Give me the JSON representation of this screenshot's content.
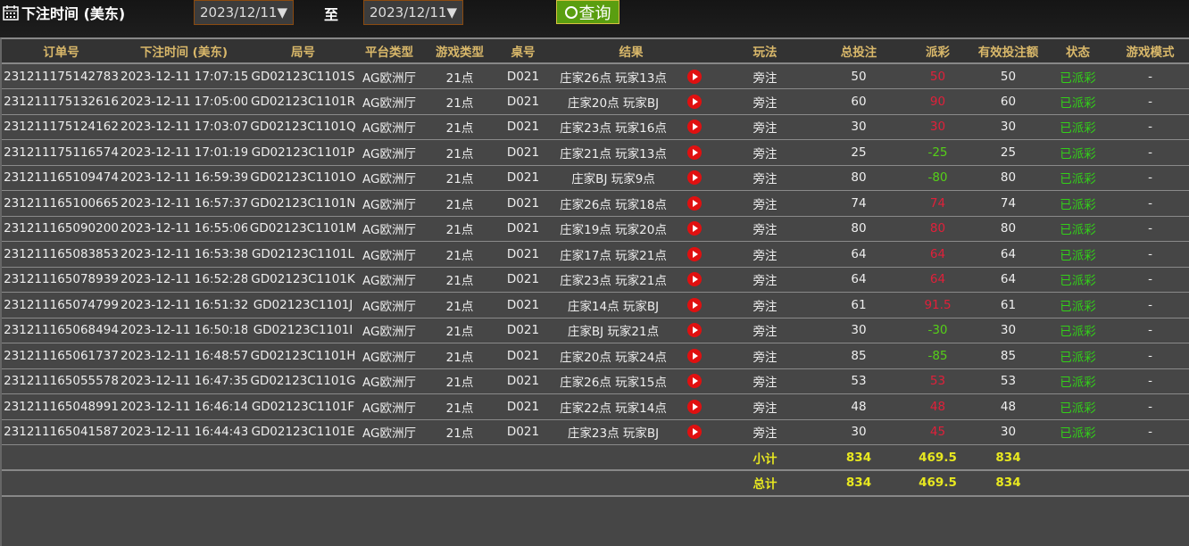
{
  "filter": {
    "label": "下注时间 (美东)",
    "start": "2023/12/11",
    "to": "至",
    "end": "2023/12/11",
    "query": "查询"
  },
  "columns": [
    "订单号",
    "下注时间 (美东)",
    "局号",
    "平台类型",
    "游戏类型",
    "桌号",
    "结果",
    "玩法",
    "总投注",
    "派彩",
    "有效投注额",
    "状态",
    "游戏模式"
  ],
  "rows": [
    [
      "231211175142783",
      "2023-12-11 17:07:15",
      "GD02123C1101S",
      "AG欧洲厅",
      "21点",
      "D021",
      "庄家26点 玩家13点",
      "旁注",
      "50",
      "50",
      "50",
      "已派彩",
      "-"
    ],
    [
      "231211175132616",
      "2023-12-11 17:05:00",
      "GD02123C1101R",
      "AG欧洲厅",
      "21点",
      "D021",
      "庄家20点 玩家BJ",
      "旁注",
      "60",
      "90",
      "60",
      "已派彩",
      "-"
    ],
    [
      "231211175124162",
      "2023-12-11 17:03:07",
      "GD02123C1101Q",
      "AG欧洲厅",
      "21点",
      "D021",
      "庄家23点 玩家16点",
      "旁注",
      "30",
      "30",
      "30",
      "已派彩",
      "-"
    ],
    [
      "231211175116574",
      "2023-12-11 17:01:19",
      "GD02123C1101P",
      "AG欧洲厅",
      "21点",
      "D021",
      "庄家21点 玩家13点",
      "旁注",
      "25",
      "-25",
      "25",
      "已派彩",
      "-"
    ],
    [
      "231211165109474",
      "2023-12-11 16:59:39",
      "GD02123C1101O",
      "AG欧洲厅",
      "21点",
      "D021",
      "庄家BJ 玩家9点",
      "旁注",
      "80",
      "-80",
      "80",
      "已派彩",
      "-"
    ],
    [
      "231211165100665",
      "2023-12-11 16:57:37",
      "GD02123C1101N",
      "AG欧洲厅",
      "21点",
      "D021",
      "庄家26点 玩家18点",
      "旁注",
      "74",
      "74",
      "74",
      "已派彩",
      "-"
    ],
    [
      "231211165090200",
      "2023-12-11 16:55:06",
      "GD02123C1101M",
      "AG欧洲厅",
      "21点",
      "D021",
      "庄家19点 玩家20点",
      "旁注",
      "80",
      "80",
      "80",
      "已派彩",
      "-"
    ],
    [
      "231211165083853",
      "2023-12-11 16:53:38",
      "GD02123C1101L",
      "AG欧洲厅",
      "21点",
      "D021",
      "庄家17点 玩家21点",
      "旁注",
      "64",
      "64",
      "64",
      "已派彩",
      "-"
    ],
    [
      "231211165078939",
      "2023-12-11 16:52:28",
      "GD02123C1101K",
      "AG欧洲厅",
      "21点",
      "D021",
      "庄家23点 玩家21点",
      "旁注",
      "64",
      "64",
      "64",
      "已派彩",
      "-"
    ],
    [
      "231211165074799",
      "2023-12-11 16:51:32",
      "GD02123C1101J",
      "AG欧洲厅",
      "21点",
      "D021",
      "庄家14点 玩家BJ",
      "旁注",
      "61",
      "91.5",
      "61",
      "已派彩",
      "-"
    ],
    [
      "231211165068494",
      "2023-12-11 16:50:18",
      "GD02123C1101I",
      "AG欧洲厅",
      "21点",
      "D021",
      "庄家BJ 玩家21点",
      "旁注",
      "30",
      "-30",
      "30",
      "已派彩",
      "-"
    ],
    [
      "231211165061737",
      "2023-12-11 16:48:57",
      "GD02123C1101H",
      "AG欧洲厅",
      "21点",
      "D021",
      "庄家20点 玩家24点",
      "旁注",
      "85",
      "-85",
      "85",
      "已派彩",
      "-"
    ],
    [
      "231211165055578",
      "2023-12-11 16:47:35",
      "GD02123C1101G",
      "AG欧洲厅",
      "21点",
      "D021",
      "庄家26点 玩家15点",
      "旁注",
      "53",
      "53",
      "53",
      "已派彩",
      "-"
    ],
    [
      "231211165048991",
      "2023-12-11 16:46:14",
      "GD02123C1101F",
      "AG欧洲厅",
      "21点",
      "D021",
      "庄家22点 玩家14点",
      "旁注",
      "48",
      "48",
      "48",
      "已派彩",
      "-"
    ],
    [
      "231211165041587",
      "2023-12-11 16:44:43",
      "GD02123C1101E",
      "AG欧洲厅",
      "21点",
      "D021",
      "庄家23点 玩家BJ",
      "旁注",
      "30",
      "45",
      "30",
      "已派彩",
      "-"
    ]
  ],
  "subtotal": {
    "label": "小计",
    "bet": "834",
    "payout": "469.5",
    "valid": "834"
  },
  "total": {
    "label": "总计",
    "bet": "834",
    "payout": "469.5",
    "valid": "834"
  },
  "colors": {
    "win": "#e0203a",
    "loss": "#55d018",
    "status": "#32d018",
    "sum": "#e8e820"
  }
}
